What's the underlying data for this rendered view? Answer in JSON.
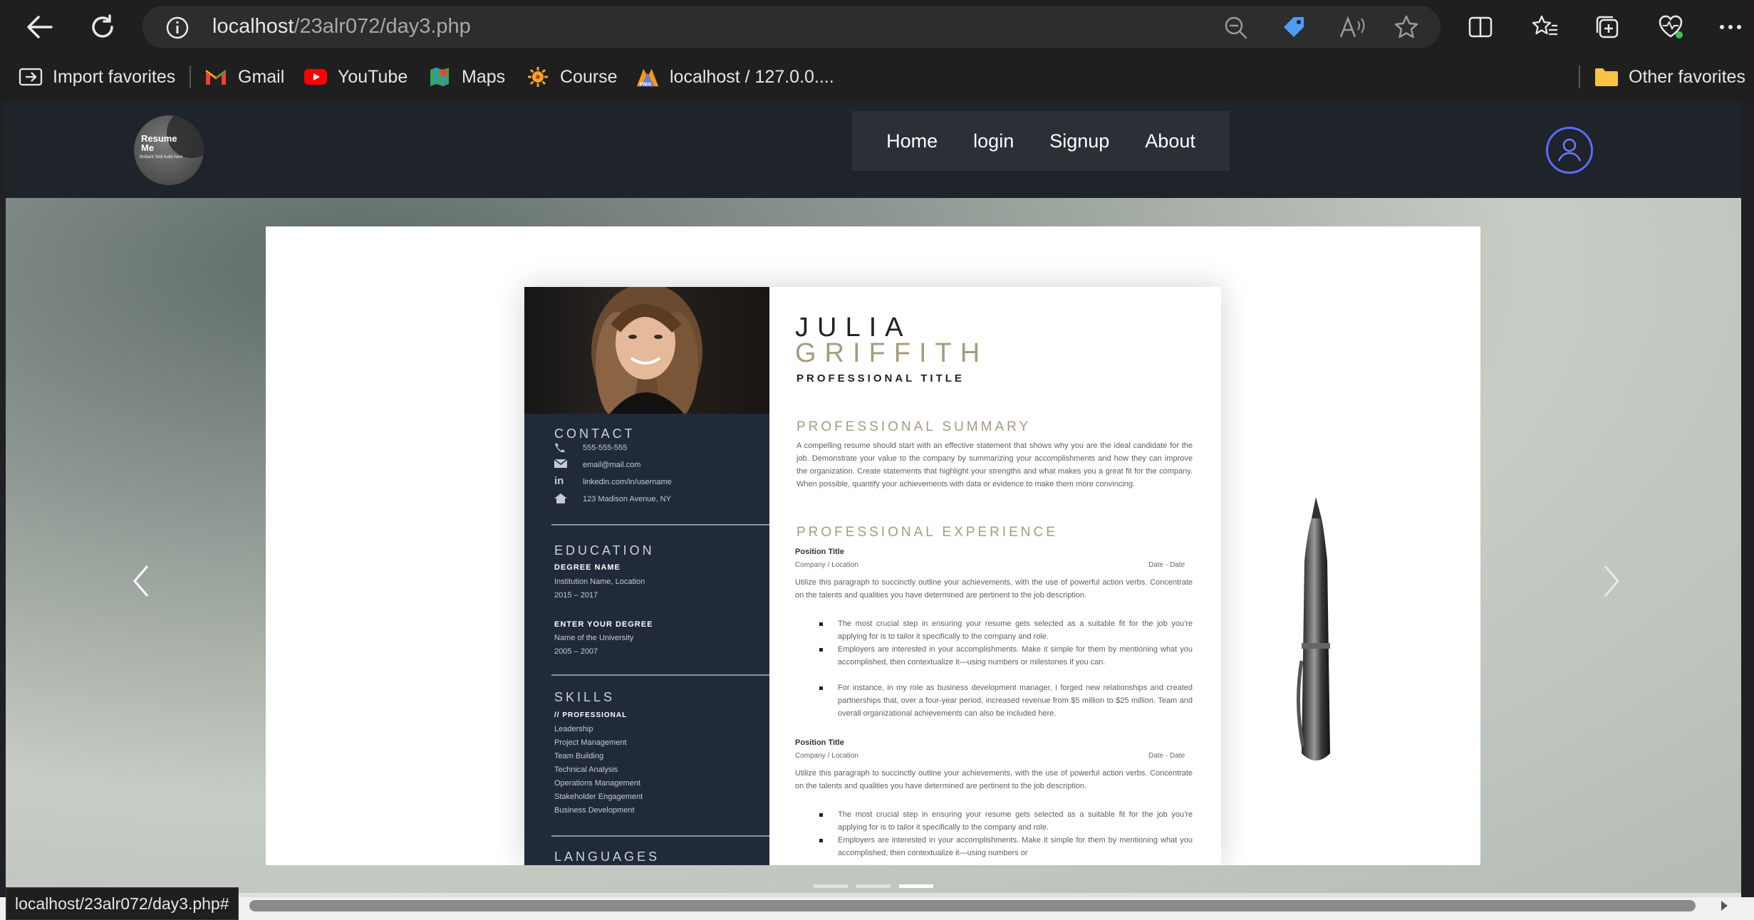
{
  "browser": {
    "url_host": "localhost",
    "url_path": "/23alr072/day3.php",
    "favorites": [
      {
        "label": "Import favorites",
        "icon": "import-icon"
      },
      {
        "label": "Gmail",
        "icon": "gmail-icon"
      },
      {
        "label": "YouTube",
        "icon": "youtube-icon"
      },
      {
        "label": "Maps",
        "icon": "maps-icon"
      },
      {
        "label": "Course",
        "icon": "course-icon"
      },
      {
        "label": "localhost / 127.0.0....",
        "icon": "phpmyadmin-icon"
      }
    ],
    "other_favorites": "Other favorites",
    "status_url": "localhost/23alr072/day3.php#"
  },
  "site": {
    "logo_line1": "Resume",
    "logo_line2": "Me",
    "logo_tagline": "Brilliant Skill build here",
    "nav": [
      "Home",
      "login",
      "Signup",
      "About"
    ]
  },
  "resume": {
    "first_name": "JULIA",
    "last_name": "GRIFFITH",
    "title": "PROFESSIONAL TITLE",
    "contact_heading": "CONTACT",
    "phone": "555-555-555",
    "email": "email@mail.com",
    "linkedin": "linkedin.com/in/username",
    "address": "123 Madison Avenue, NY",
    "education_heading": "EDUCATION",
    "degree1": "DEGREE NAME",
    "inst1": "Institution Name, Location",
    "years1": "2015 – 2017",
    "degree2": "ENTER YOUR DEGREE",
    "inst2": "Name of the University",
    "years2": "2005 – 2007",
    "skills_heading": "SKILLS",
    "skills_sub": "// PROFESSIONAL",
    "skills": [
      "Leadership",
      "Project Management",
      "Team Building",
      "Technical Analysis",
      "Operations Management",
      "Stakeholder Engagement",
      "Business Development"
    ],
    "languages_heading": "LANGUAGES",
    "summary_heading": "PROFESSIONAL SUMMARY",
    "summary_text": "A compelling resume should start with an effective statement that shows why you are the ideal candidate for the job. Demonstrate your value to the company by summarizing your accomplishments and how they can improve the organization. Create statements that highlight your strengths and what makes you a great fit for the company. When possible, quantify your achievements with data or evidence to make them more convincing.",
    "experience_heading": "PROFESSIONAL EXPERIENCE",
    "position_title": "Position Title",
    "company": "Company / Location",
    "dates": "Date - Date",
    "exp_text": "Utilize this paragraph to succinctly outline your achievements, with the use of powerful action verbs. Concentrate on the talents and qualities you have determined are pertinent to the job description.",
    "bullet1": "The most crucial step in ensuring your resume gets selected as a suitable fit for the job you're applying for is to tailor it specifically to the company and role.",
    "bullet2": "Employers are interested in your accomplishments. Make it simple for them by mentioning what you accomplished, then contextualize it—using numbers or milestones if you can.",
    "bullet3": "For instance, in my role as business development manager, I forged new relationships and created partnerships that, over a four-year period, increased revenue from $5 million to $25 million. Team and overall organizational achievements can also be included here.",
    "bullet2_cut": "Employers are interested in your accomplishments. Make it simple for them by mentioning what you accomplished, then contextualize it—using numbers or"
  },
  "carousel": {
    "active_index": 2,
    "slide_count": 3
  }
}
